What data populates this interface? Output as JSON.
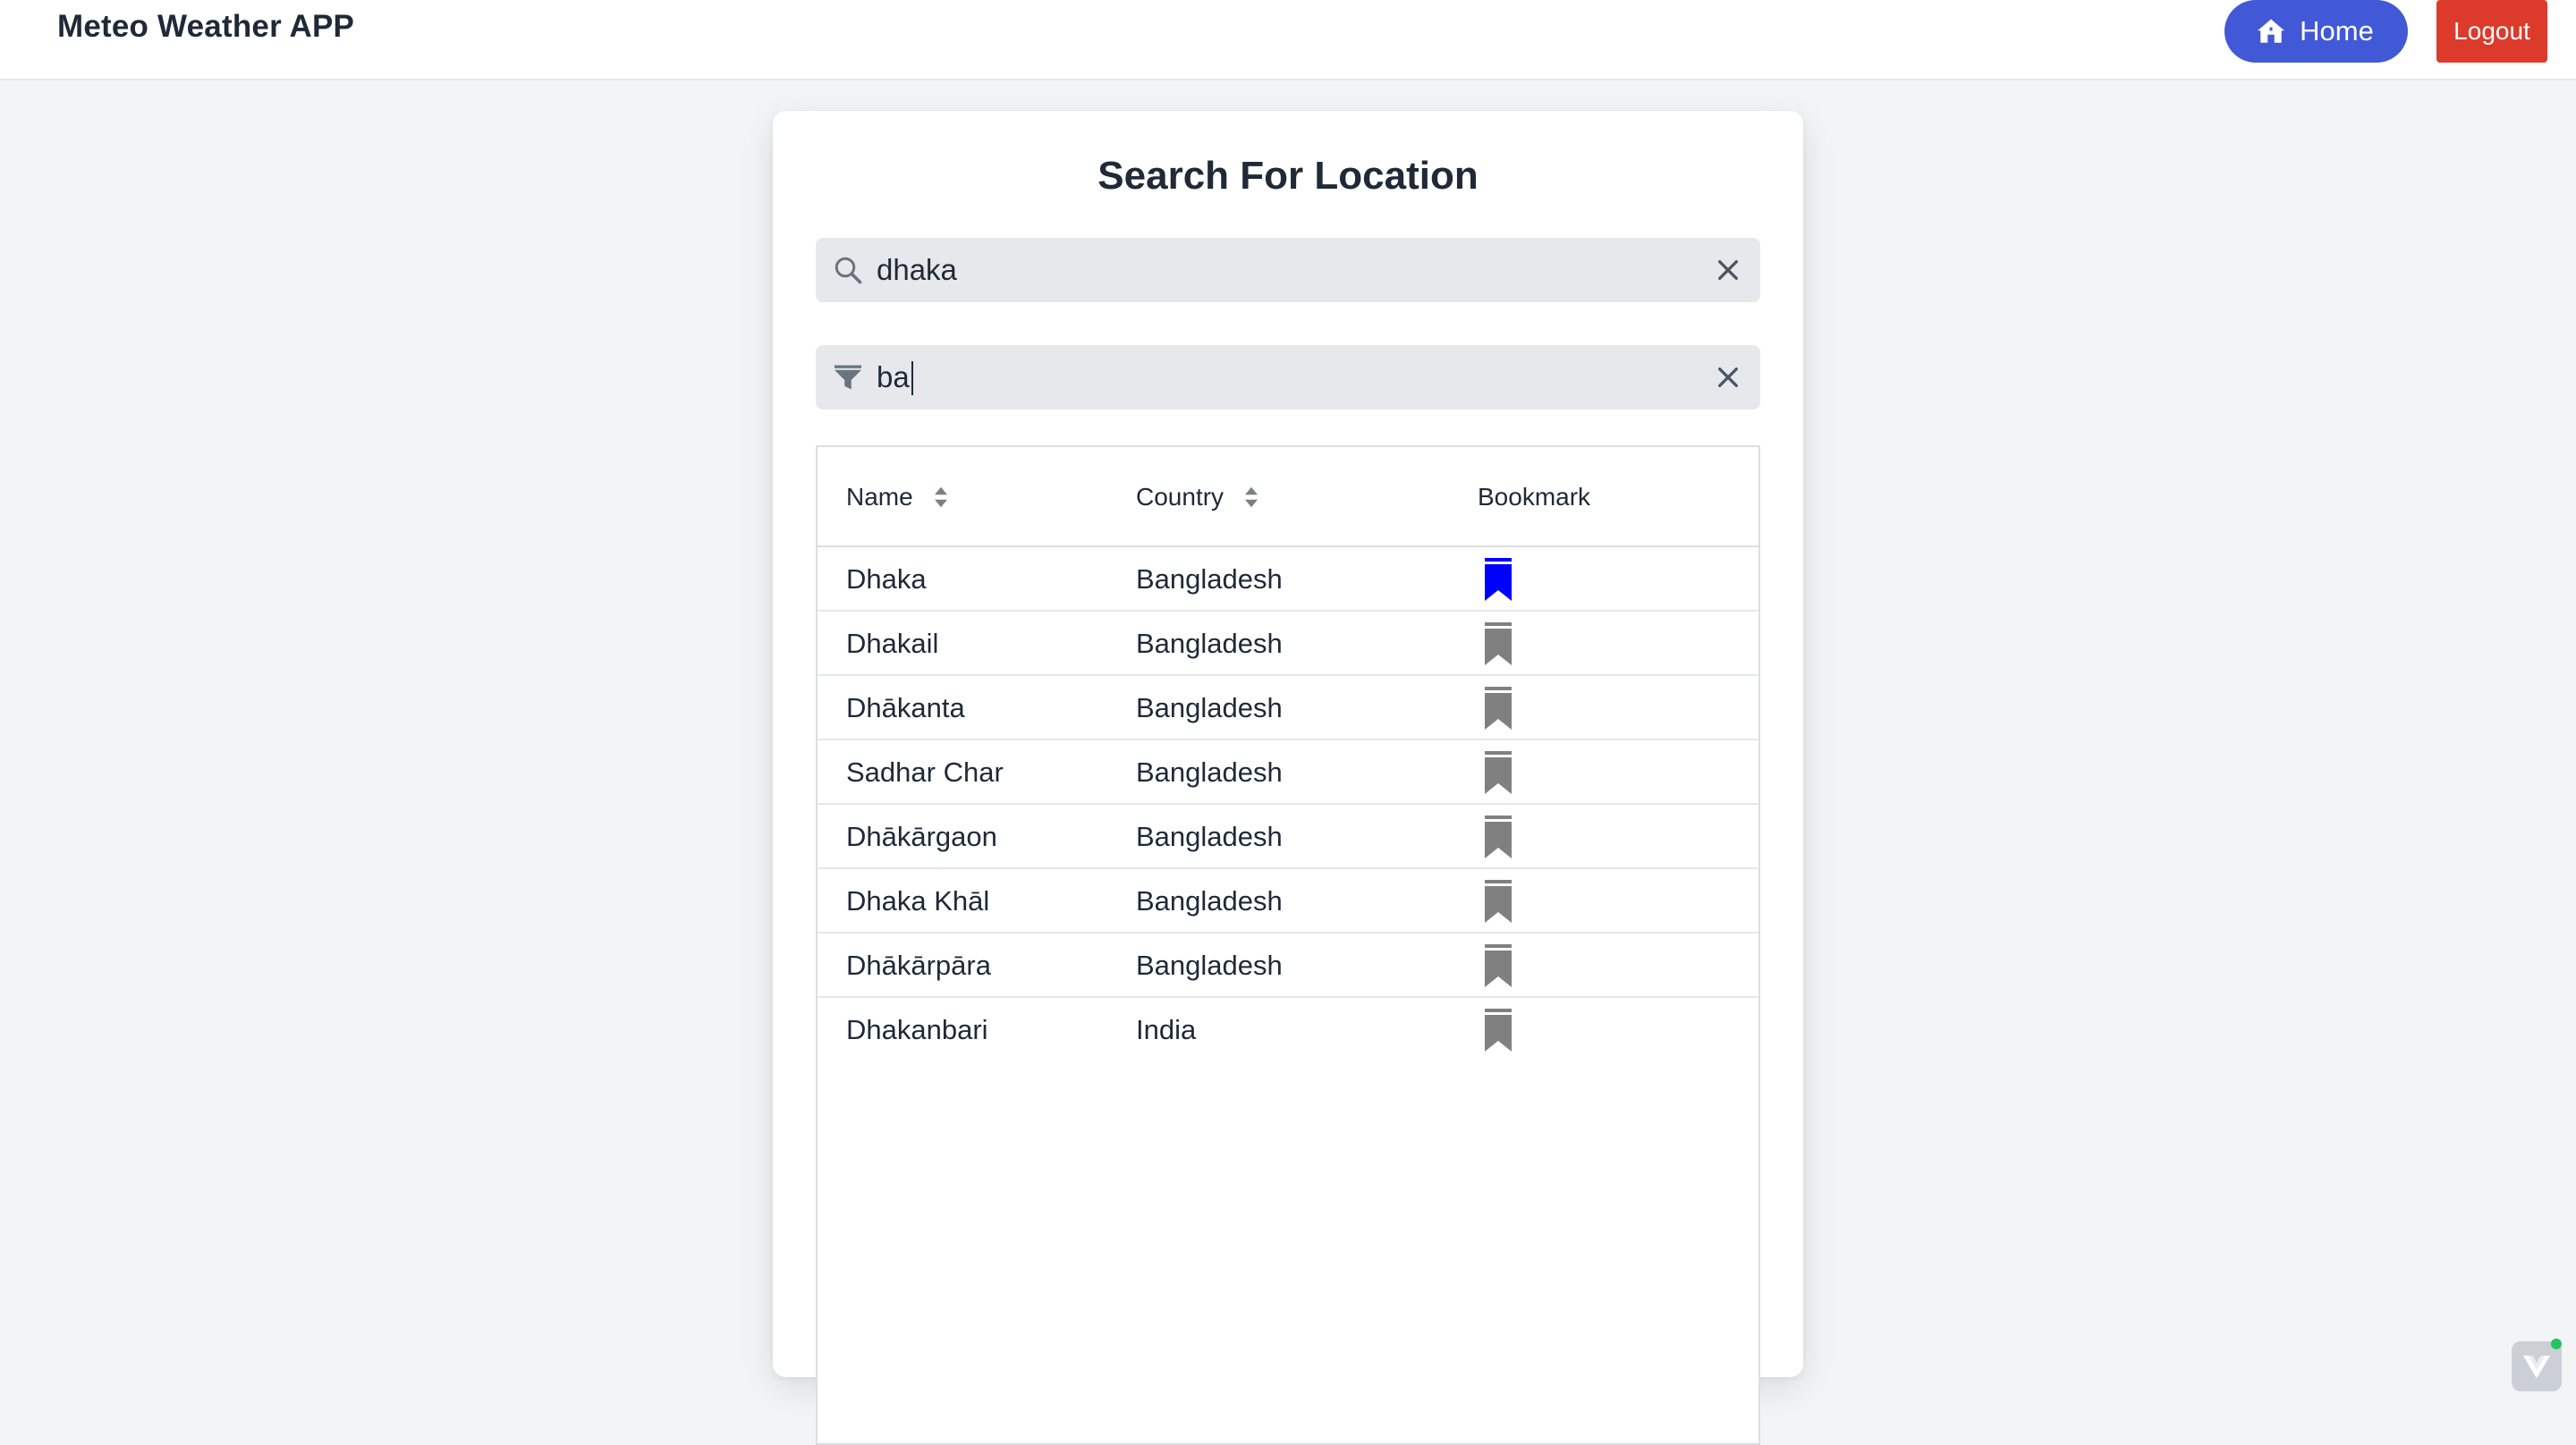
{
  "header": {
    "brand": "Meteo Weather APP",
    "home_label": "Home",
    "logout_label": "Logout"
  },
  "search_card": {
    "title": "Search For Location",
    "search_value": "dhaka",
    "filter_value": "ba"
  },
  "table": {
    "columns": {
      "name": "Name",
      "country": "Country",
      "bookmark": "Bookmark"
    },
    "rows": [
      {
        "name": "Dhaka",
        "country": "Bangladesh",
        "bookmarked": true
      },
      {
        "name": "Dhakail",
        "country": "Bangladesh",
        "bookmarked": false
      },
      {
        "name": "Dhākanta",
        "country": "Bangladesh",
        "bookmarked": false
      },
      {
        "name": "Sadhar Char",
        "country": "Bangladesh",
        "bookmarked": false
      },
      {
        "name": "Dhākārgaon",
        "country": "Bangladesh",
        "bookmarked": false
      },
      {
        "name": "Dhaka Khāl",
        "country": "Bangladesh",
        "bookmarked": false
      },
      {
        "name": "Dhākārpāra",
        "country": "Bangladesh",
        "bookmarked": false
      },
      {
        "name": "Dhakanbari",
        "country": "India",
        "bookmarked": false
      }
    ]
  },
  "colors": {
    "home_button": "#4159d6",
    "logout_button": "#dc3a2b",
    "bookmark_active": "#0000ff",
    "bookmark_inactive": "#808080"
  }
}
